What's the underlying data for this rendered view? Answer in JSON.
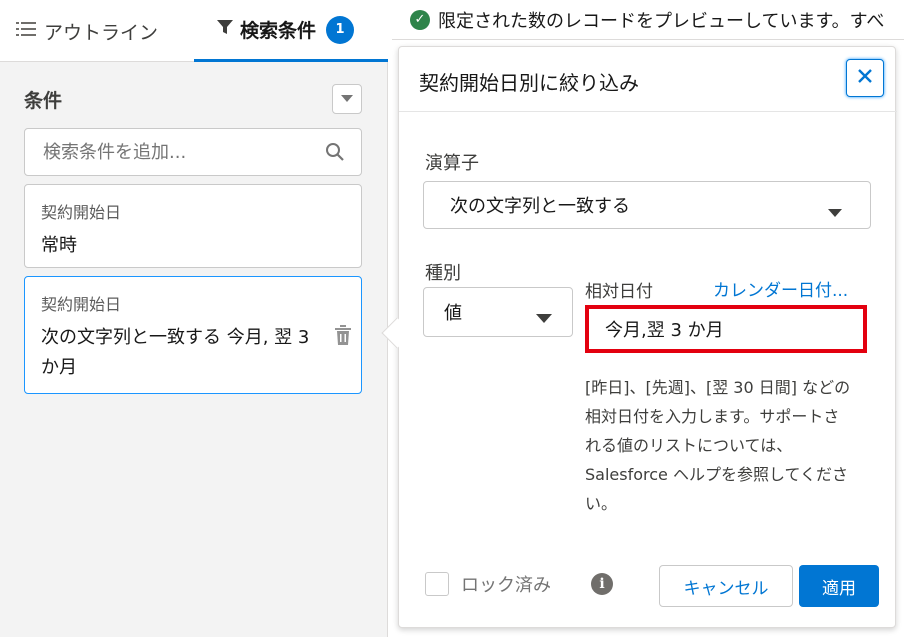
{
  "tabs": {
    "outline_label": "アウトライン",
    "filters_label": "検索条件",
    "filters_count": "1"
  },
  "conditions": {
    "title": "条件",
    "search_placeholder": "検索条件を追加...",
    "cards": [
      {
        "label": "契約開始日",
        "value": "常時"
      },
      {
        "label": "契約開始日",
        "value": "次の文字列と一致する 今月, 翌 3 か月"
      }
    ]
  },
  "banner": {
    "text": "限定された数のレコードをプレビューしています。すべ"
  },
  "popover": {
    "title": "契約開始日別に絞り込み",
    "operator_label": "演算子",
    "operator_value": "次の文字列と一致する",
    "type_label": "種別",
    "type_value": "値",
    "relative_label": "相対日付",
    "calendar_link": "カレンダー日付...",
    "relative_value": "今月,翌 3 か月",
    "help_text": "[昨日]、[先週]、[翌 30 日間] などの相対日付を入力します。サポートされる値のリストについては、Salesforce ヘルプを参照してください。",
    "lock_label": "ロック済み",
    "cancel_label": "キャンセル",
    "apply_label": "適用"
  },
  "colors": {
    "brand": "#0176d3",
    "highlight": "#e3000f",
    "success": "#2e844a"
  }
}
